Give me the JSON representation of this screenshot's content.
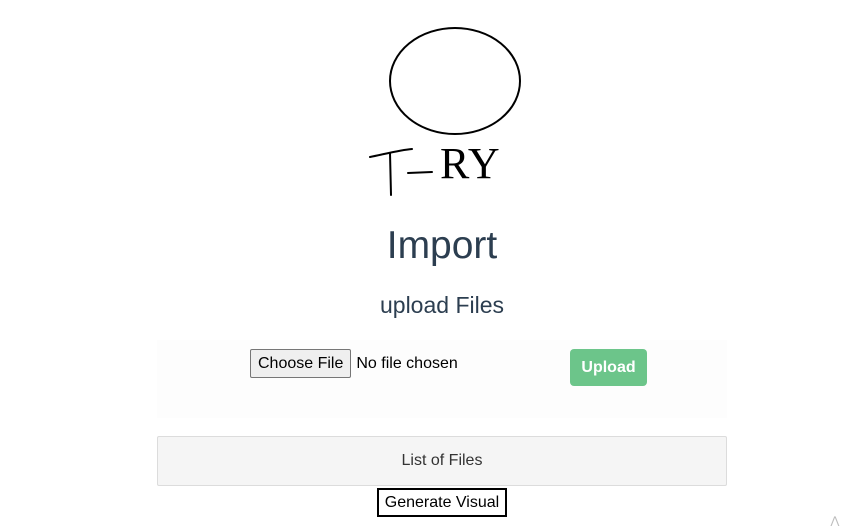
{
  "logo": {
    "letters": "RY",
    "brand_color": "#000000"
  },
  "page": {
    "title": "Import",
    "subtitle": "upload Files"
  },
  "upload": {
    "choose_label": "Choose File",
    "status": "No file chosen",
    "upload_label": "Upload",
    "upload_color": "#6cc58a"
  },
  "files": {
    "list_label": "List of Files"
  },
  "actions": {
    "generate_label": "Generate Visual"
  },
  "colors": {
    "heading": "#2c3e50",
    "panel_bg": "#f5f5f5"
  },
  "icons": {
    "corner": "resize-grip-icon"
  }
}
